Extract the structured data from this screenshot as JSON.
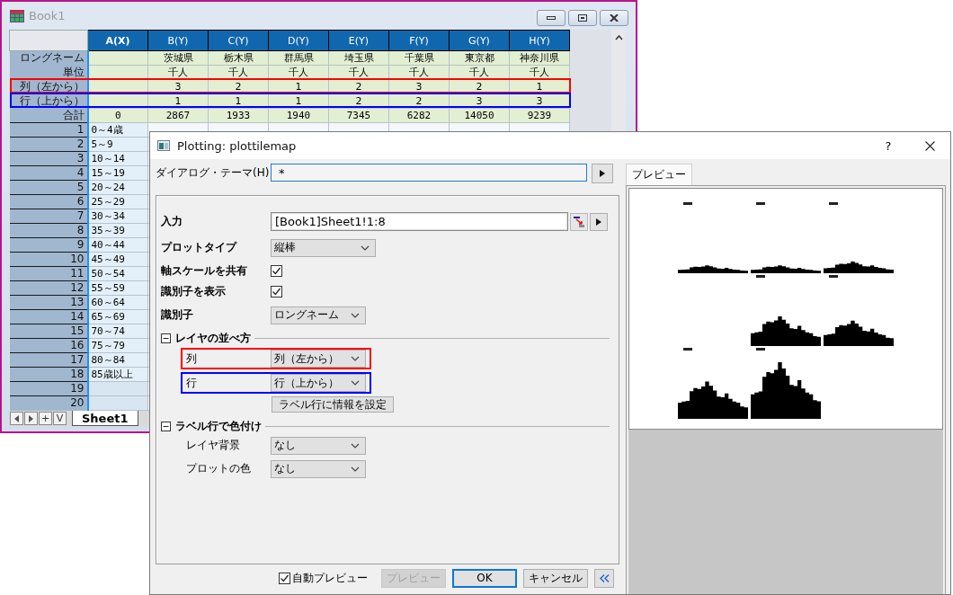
{
  "workbook": {
    "title": "Book1",
    "columns": [
      {
        "header": "A(X)",
        "selected": true
      },
      {
        "header": "B(Y)",
        "selected": false
      },
      {
        "header": "C(Y)",
        "selected": false
      },
      {
        "header": "D(Y)",
        "selected": false
      },
      {
        "header": "E(Y)",
        "selected": false
      },
      {
        "header": "F(Y)",
        "selected": false
      },
      {
        "header": "G(Y)",
        "selected": false
      },
      {
        "header": "H(Y)",
        "selected": false
      }
    ],
    "label_rows": [
      {
        "kind": "longname",
        "header": "ロングネーム",
        "values": [
          "茨城県",
          "栃木県",
          "群馬県",
          "埼玉県",
          "千葉県",
          "東京都",
          "神奈川県"
        ]
      },
      {
        "kind": "unit",
        "header": "単位",
        "values": [
          "千人",
          "千人",
          "千人",
          "千人",
          "千人",
          "千人",
          "千人"
        ]
      },
      {
        "kind": "column_order",
        "header": "列（左から）",
        "values": [
          "3",
          "2",
          "1",
          "2",
          "3",
          "2",
          "1"
        ],
        "color": "#ff0000"
      },
      {
        "kind": "row_order",
        "header": "行（上から）",
        "values": [
          "1",
          "1",
          "1",
          "2",
          "2",
          "3",
          "3"
        ],
        "color": "#0000ff"
      },
      {
        "kind": "total",
        "header": "合計",
        "a": "0",
        "values": [
          "2867",
          "1933",
          "1940",
          "7345",
          "6282",
          "14050",
          "9239"
        ]
      }
    ],
    "rows": [
      {
        "header": "1",
        "a": "0～4歳"
      },
      {
        "header": "2",
        "a": "5～9"
      },
      {
        "header": "3",
        "a": "10～14"
      },
      {
        "header": "4",
        "a": "15～19"
      },
      {
        "header": "5",
        "a": "20～24"
      },
      {
        "header": "6",
        "a": "25～29"
      },
      {
        "header": "7",
        "a": "30～34"
      },
      {
        "header": "8",
        "a": "35～39"
      },
      {
        "header": "9",
        "a": "40～44"
      },
      {
        "header": "10",
        "a": "45～49"
      },
      {
        "header": "11",
        "a": "50～54"
      },
      {
        "header": "12",
        "a": "55～59"
      },
      {
        "header": "13",
        "a": "60～64"
      },
      {
        "header": "14",
        "a": "65～69"
      },
      {
        "header": "15",
        "a": "70～74"
      },
      {
        "header": "16",
        "a": "75～79"
      },
      {
        "header": "17",
        "a": "80～84"
      },
      {
        "header": "18",
        "a": "85歳以上"
      },
      {
        "header": "19"
      },
      {
        "header": "20"
      }
    ],
    "sheet_nav": [
      "+",
      "V"
    ],
    "sheet_tabs": [
      {
        "label": "Sheet1",
        "selected": true
      }
    ]
  },
  "dialog": {
    "title": "Plotting: plottilemap",
    "help": "?",
    "theme": {
      "label": "ダイアログ・テーマ(H)",
      "value": "*"
    },
    "form": [
      {
        "kind": "input",
        "label": "入力",
        "value": "[Book1]Sheet1!1:8"
      },
      {
        "kind": "dropdown",
        "label": "プロットタイプ",
        "value": "縦棒"
      },
      {
        "kind": "checkbox",
        "label": "軸スケールを共有",
        "checked": true
      },
      {
        "kind": "checkbox",
        "label": "識別子を表示",
        "checked": true
      },
      {
        "kind": "dropdown",
        "label": "識別子",
        "value": "ロングネーム"
      },
      {
        "kind": "section",
        "label": "レイヤの並べ方",
        "expanded": true,
        "children": [
          {
            "kind": "dropdown",
            "label": "列",
            "value": "列（左から）",
            "color": "#ff0000"
          },
          {
            "kind": "dropdown",
            "label": "行",
            "value": "行（上から）",
            "color": "#0000ff"
          },
          {
            "kind": "button",
            "label": "ラベル行に情報を設定"
          }
        ]
      },
      {
        "kind": "section",
        "label": "ラベル行で色付け",
        "expanded": true,
        "children": [
          {
            "kind": "dropdown",
            "label": "レイヤ背景",
            "value": "なし"
          },
          {
            "kind": "dropdown",
            "label": "プロットの色",
            "value": "なし"
          }
        ]
      }
    ],
    "auto_preview": {
      "label": "自動プレビュー",
      "checked": true
    },
    "buttons": [
      {
        "label": "プレビュー",
        "disabled": true,
        "default": false
      },
      {
        "label": "OK",
        "disabled": false,
        "default": true
      },
      {
        "label": "キャンセル",
        "disabled": false,
        "default": false
      }
    ],
    "preview_tab": {
      "label": "プレビュー",
      "selected": true
    }
  }
}
